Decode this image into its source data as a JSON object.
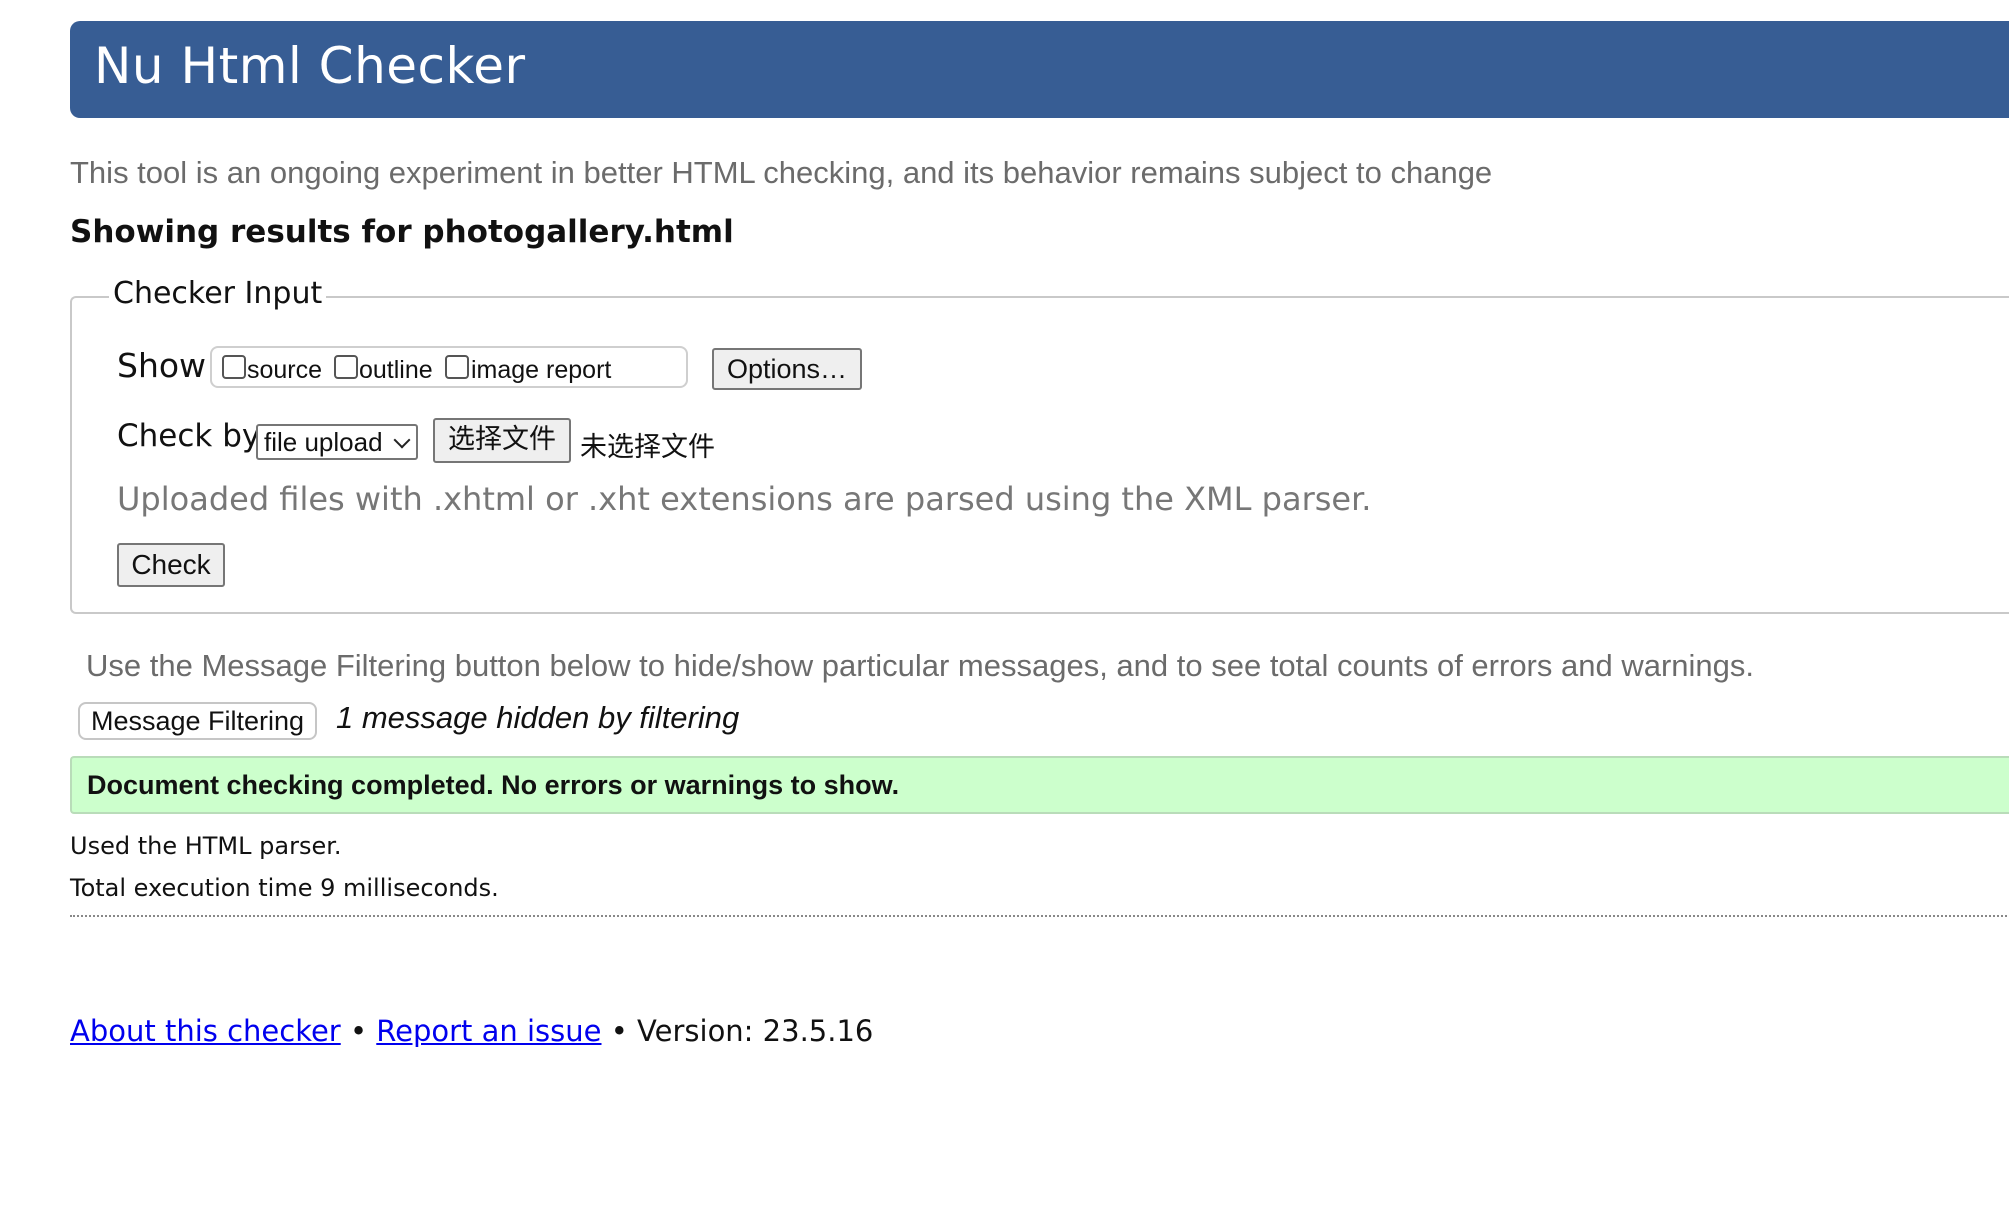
{
  "header": {
    "title": "Nu Html Checker"
  },
  "tagline": "This tool is an ongoing experiment in better HTML checking, and its behavior remains subject to change",
  "results_heading": "Showing results for photogallery.html",
  "checker_input": {
    "legend": "Checker Input",
    "show_label": "Show",
    "show_options": [
      {
        "label": "source",
        "checked": false
      },
      {
        "label": "outline",
        "checked": false
      },
      {
        "label": "image report",
        "checked": false
      }
    ],
    "options_button": "Options…",
    "check_by_label": "Check by",
    "check_by_selected": "file upload",
    "choose_file_button": "选择文件",
    "no_file_text": "未选择文件",
    "parser_note": "Uploaded files with .xhtml or .xht extensions are parsed using the XML parser.",
    "check_button": "Check"
  },
  "filtering": {
    "note": "Use the Message Filtering button below to hide/show particular messages, and to see total counts of errors and warnings.",
    "button": "Message Filtering",
    "hidden_count": "1 message hidden by filtering"
  },
  "result": {
    "success_message": "Document checking completed. No errors or warnings to show.",
    "parser_used": "Used the HTML parser.",
    "execution_time": "Total execution time 9 milliseconds."
  },
  "footer": {
    "about_link": "About this checker",
    "separator1": " • ",
    "report_link": "Report an issue",
    "separator2": " • ",
    "version": "Version: 23.5.16"
  },
  "colors": {
    "banner": "#375d94",
    "success_background": "#ccffcc",
    "link": "#0000ee"
  }
}
